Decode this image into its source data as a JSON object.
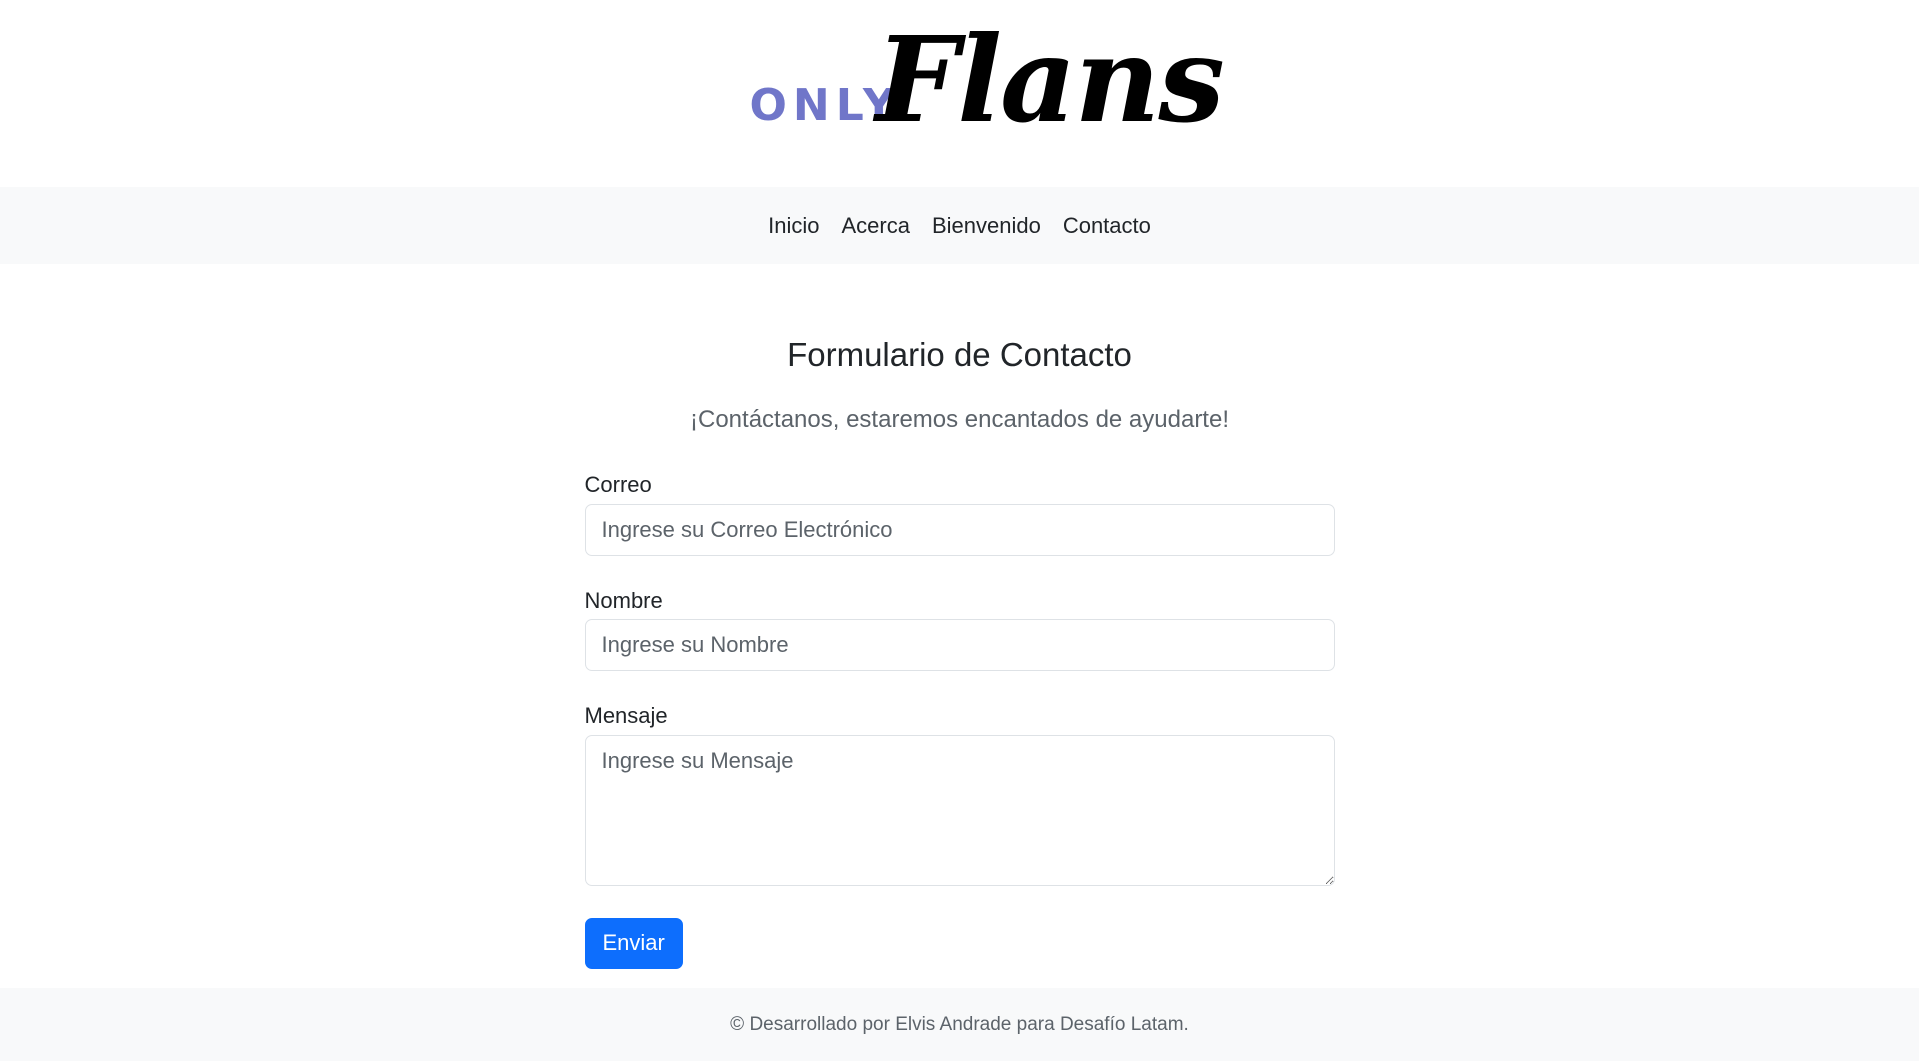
{
  "header": {
    "logo_prefix": "ONLY",
    "logo_script": "Flans"
  },
  "nav": {
    "items": [
      {
        "label": "Inicio"
      },
      {
        "label": "Acerca"
      },
      {
        "label": "Bienvenido"
      },
      {
        "label": "Contacto"
      }
    ]
  },
  "form": {
    "title": "Formulario de Contacto",
    "subtitle": "¡Contáctanos, estaremos encantados de ayudarte!",
    "email": {
      "label": "Correo",
      "placeholder": "Ingrese su Correo Electrónico",
      "value": ""
    },
    "name": {
      "label": "Nombre",
      "placeholder": "Ingrese su Nombre",
      "value": ""
    },
    "message": {
      "label": "Mensaje",
      "placeholder": "Ingrese su Mensaje",
      "value": ""
    },
    "submit_label": "Enviar"
  },
  "footer": {
    "text": "© Desarrollado por Elvis Andrade para Desafío Latam."
  },
  "colors": {
    "accent": "#0d6efd",
    "logo_prefix": "#7076c9",
    "nav_bg": "#f8f9fa",
    "footer_bg": "#f8f9fa"
  }
}
